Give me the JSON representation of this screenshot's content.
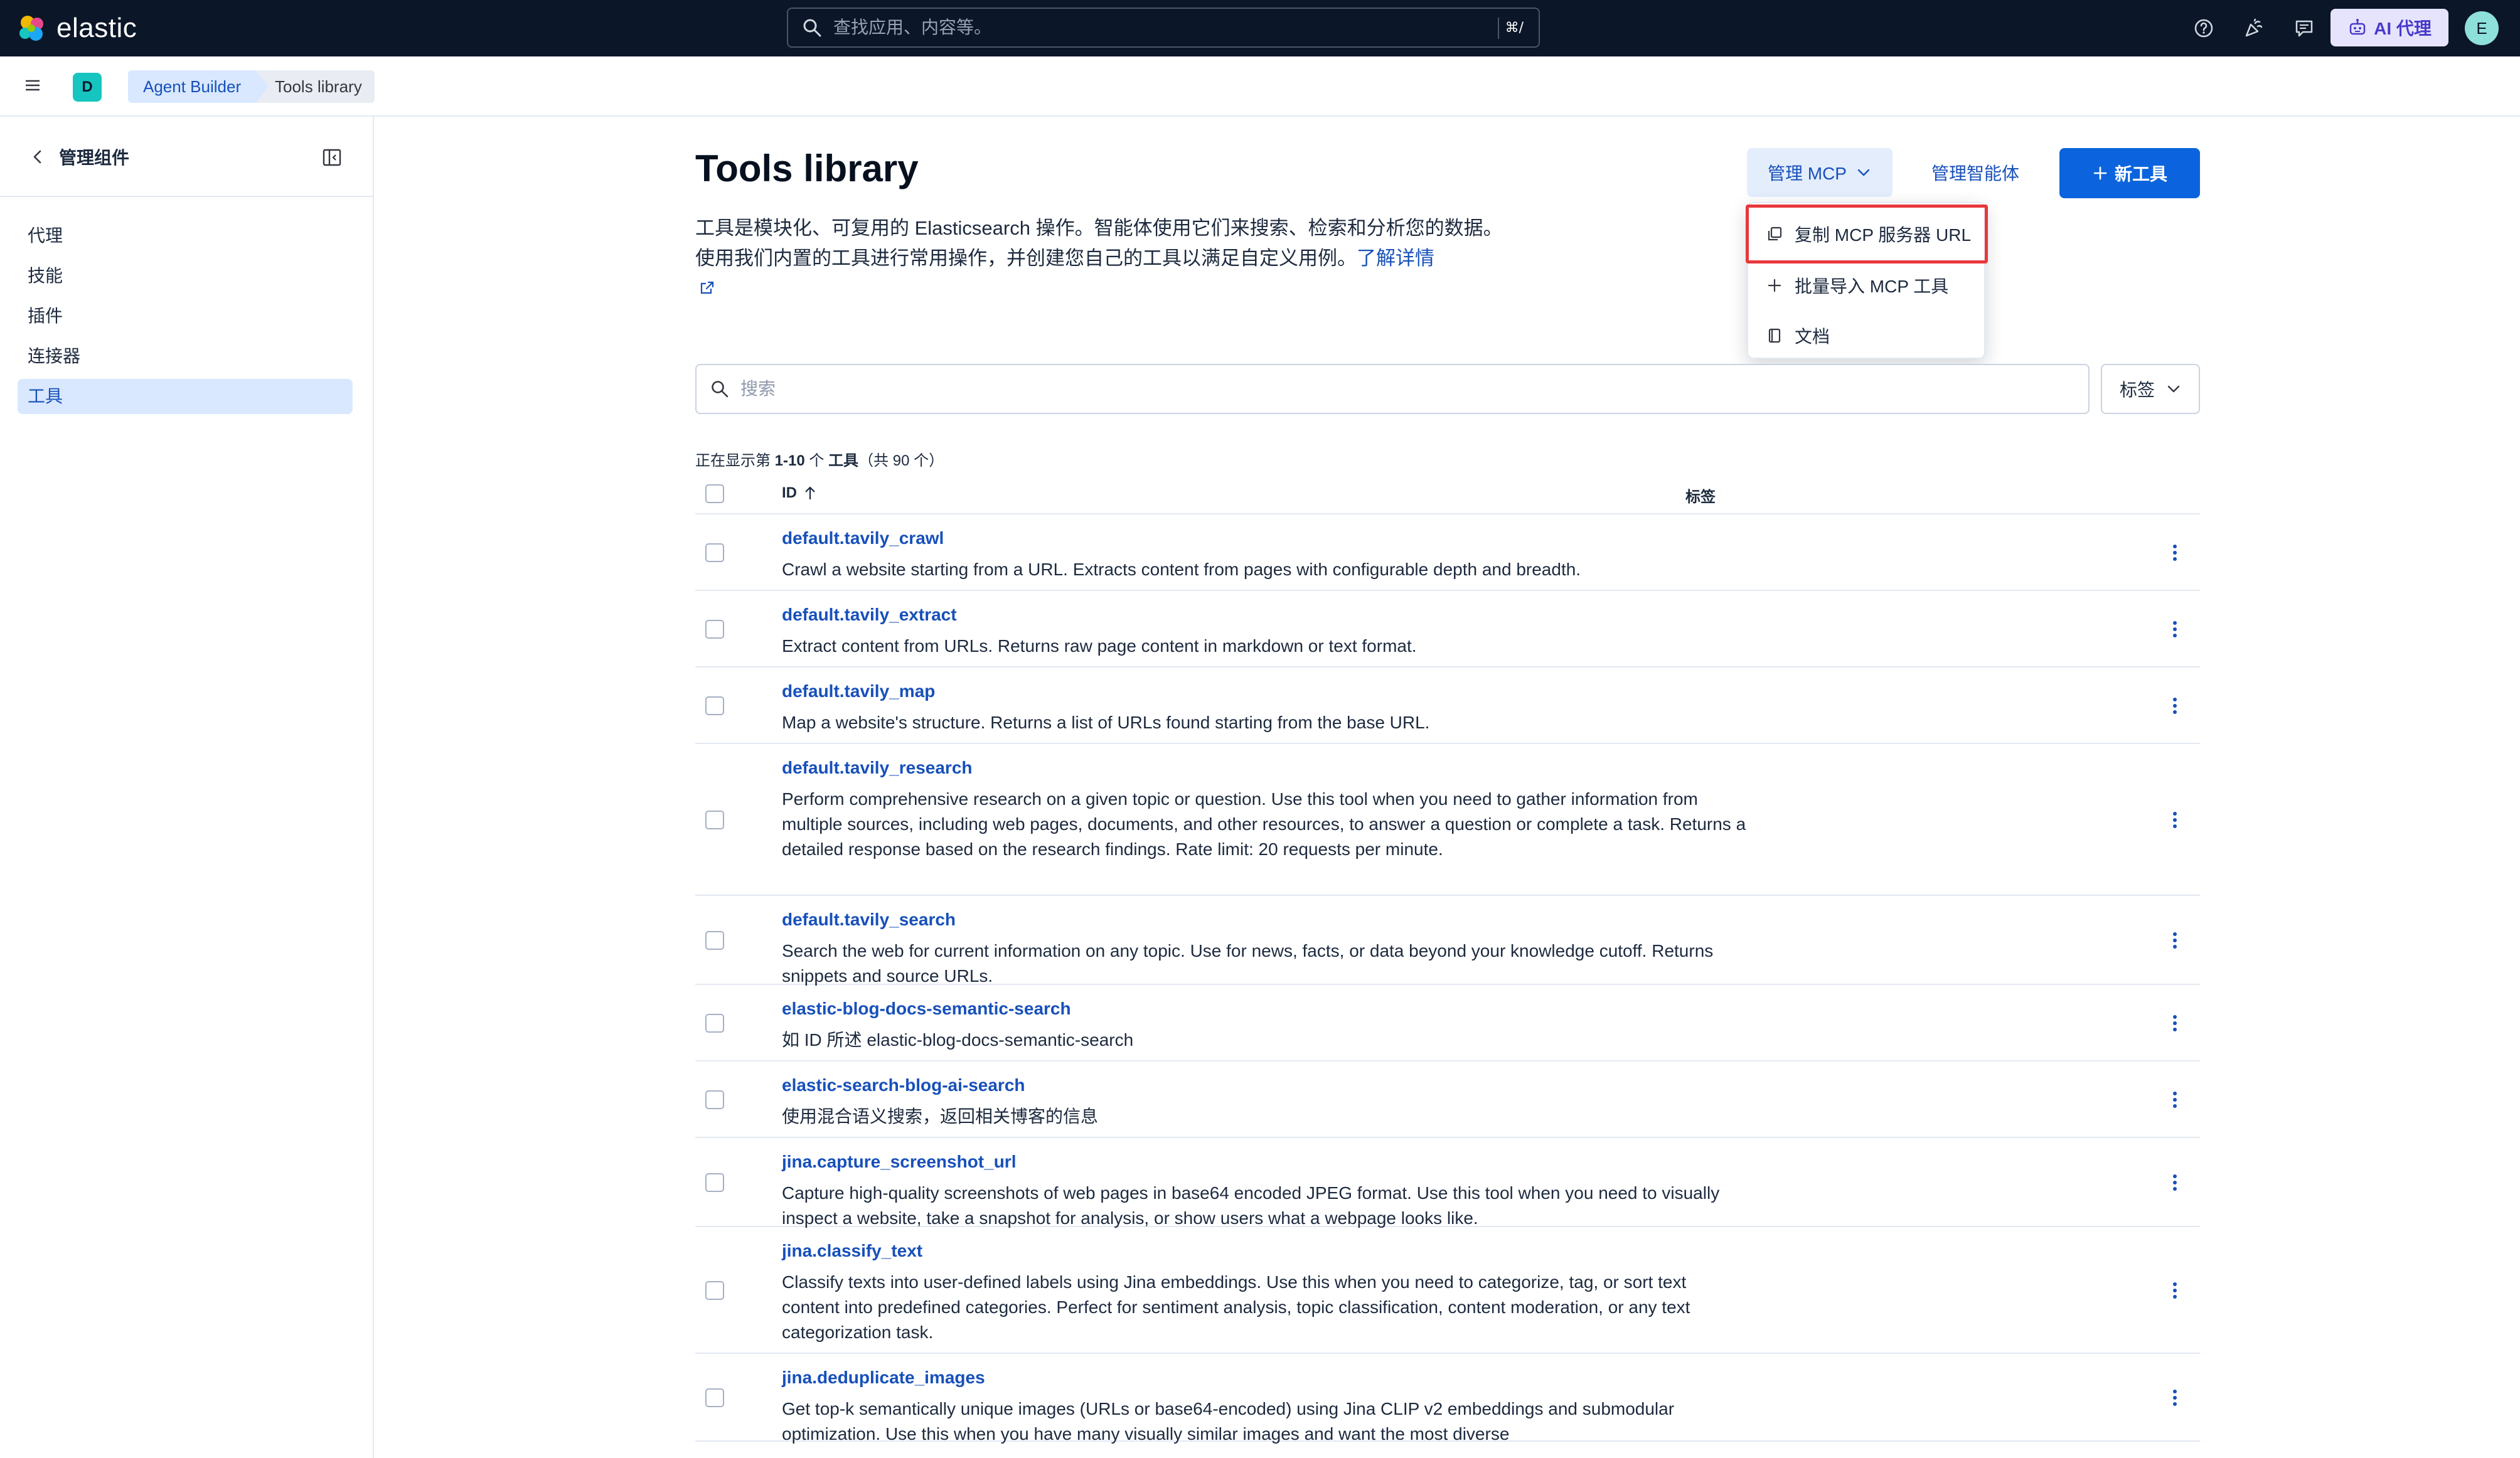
{
  "header": {
    "brand": "elastic",
    "search_placeholder": "查找应用、内容等。",
    "search_shortcut": "⌘/",
    "ai_button": "AI 代理",
    "user_initial": "E"
  },
  "breadcrumbs": {
    "space_initial": "D",
    "items": [
      "Agent Builder",
      "Tools library"
    ]
  },
  "sidenav": {
    "title": "管理组件",
    "items": [
      {
        "label": "代理"
      },
      {
        "label": "技能"
      },
      {
        "label": "插件"
      },
      {
        "label": "连接器"
      },
      {
        "label": "工具",
        "active": true
      }
    ]
  },
  "page": {
    "title": "Tools library",
    "intro": "工具是模块化、可复用的 Elasticsearch 操作。智能体使用它们来搜索、检索和分析您的数据。使用我们内置的工具进行常用操作，并创建您自己的工具以满足自定义用例。",
    "learn_more": "了解详情",
    "manage_mcp": "管理 MCP",
    "manage_agents": "管理智能体",
    "new_tool": "新工具",
    "mcp_menu": [
      {
        "label": "复制 MCP 服务器 URL",
        "icon": "copy-icon"
      },
      {
        "label": "批量导入 MCP 工具",
        "icon": "plus-icon"
      },
      {
        "label": "文档",
        "icon": "book-icon"
      }
    ],
    "search_placeholder": "搜索",
    "tags_filter": "标签",
    "count_prefix": "正在显示第 ",
    "count_range": "1-10",
    "count_mid": " 个 ",
    "count_unit": "工具",
    "count_suffix": "（共 90 个）"
  },
  "table": {
    "columns": {
      "id": "ID",
      "tags": "标签"
    },
    "rows": [
      {
        "id": "default.tavily_crawl",
        "desc": "Crawl a website starting from a URL. Extracts content from pages with configurable depth and breadth."
      },
      {
        "id": "default.tavily_extract",
        "desc": "Extract content from URLs. Returns raw page content in markdown or text format."
      },
      {
        "id": "default.tavily_map",
        "desc": "Map a website's structure. Returns a list of URLs found starting from the base URL."
      },
      {
        "id": "default.tavily_research",
        "desc": "Perform comprehensive research on a given topic or question. Use this tool when you need to gather information from multiple sources, including web pages, documents, and other resources, to answer a question or complete a task. Returns a detailed response based on the research findings. Rate limit: 20 requests per minute."
      },
      {
        "id": "default.tavily_search",
        "desc": "Search the web for current information on any topic. Use for news, facts, or data beyond your knowledge cutoff. Returns snippets and source URLs."
      },
      {
        "id": "elastic-blog-docs-semantic-search",
        "desc": "如 ID 所述 elastic-blog-docs-semantic-search"
      },
      {
        "id": "elastic-search-blog-ai-search",
        "desc": "使用混合语义搜索，返回相关博客的信息"
      },
      {
        "id": "jina.capture_screenshot_url",
        "desc": "Capture high-quality screenshots of web pages in base64 encoded JPEG format. Use this tool when you need to visually inspect a website, take a snapshot for analysis, or show users what a webpage looks like."
      },
      {
        "id": "jina.classify_text",
        "desc": "Classify texts into user-defined labels using Jina embeddings. Use this when you need to categorize, tag, or sort text content into predefined categories. Perfect for sentiment analysis, topic classification, content moderation, or any text categorization task."
      },
      {
        "id": "jina.deduplicate_images",
        "desc": "Get top-k semantically unique images (URLs or base64-encoded) using Jina CLIP v2 embeddings and submodular optimization. Use this when you have many visually similar images and want the most diverse"
      }
    ]
  },
  "colors": {
    "header_bg": "#0b1628",
    "primary": "#0b64dd",
    "link": "#1750ba",
    "active_nav_bg": "#d9e8ff",
    "highlight_red": "#e8373b"
  }
}
